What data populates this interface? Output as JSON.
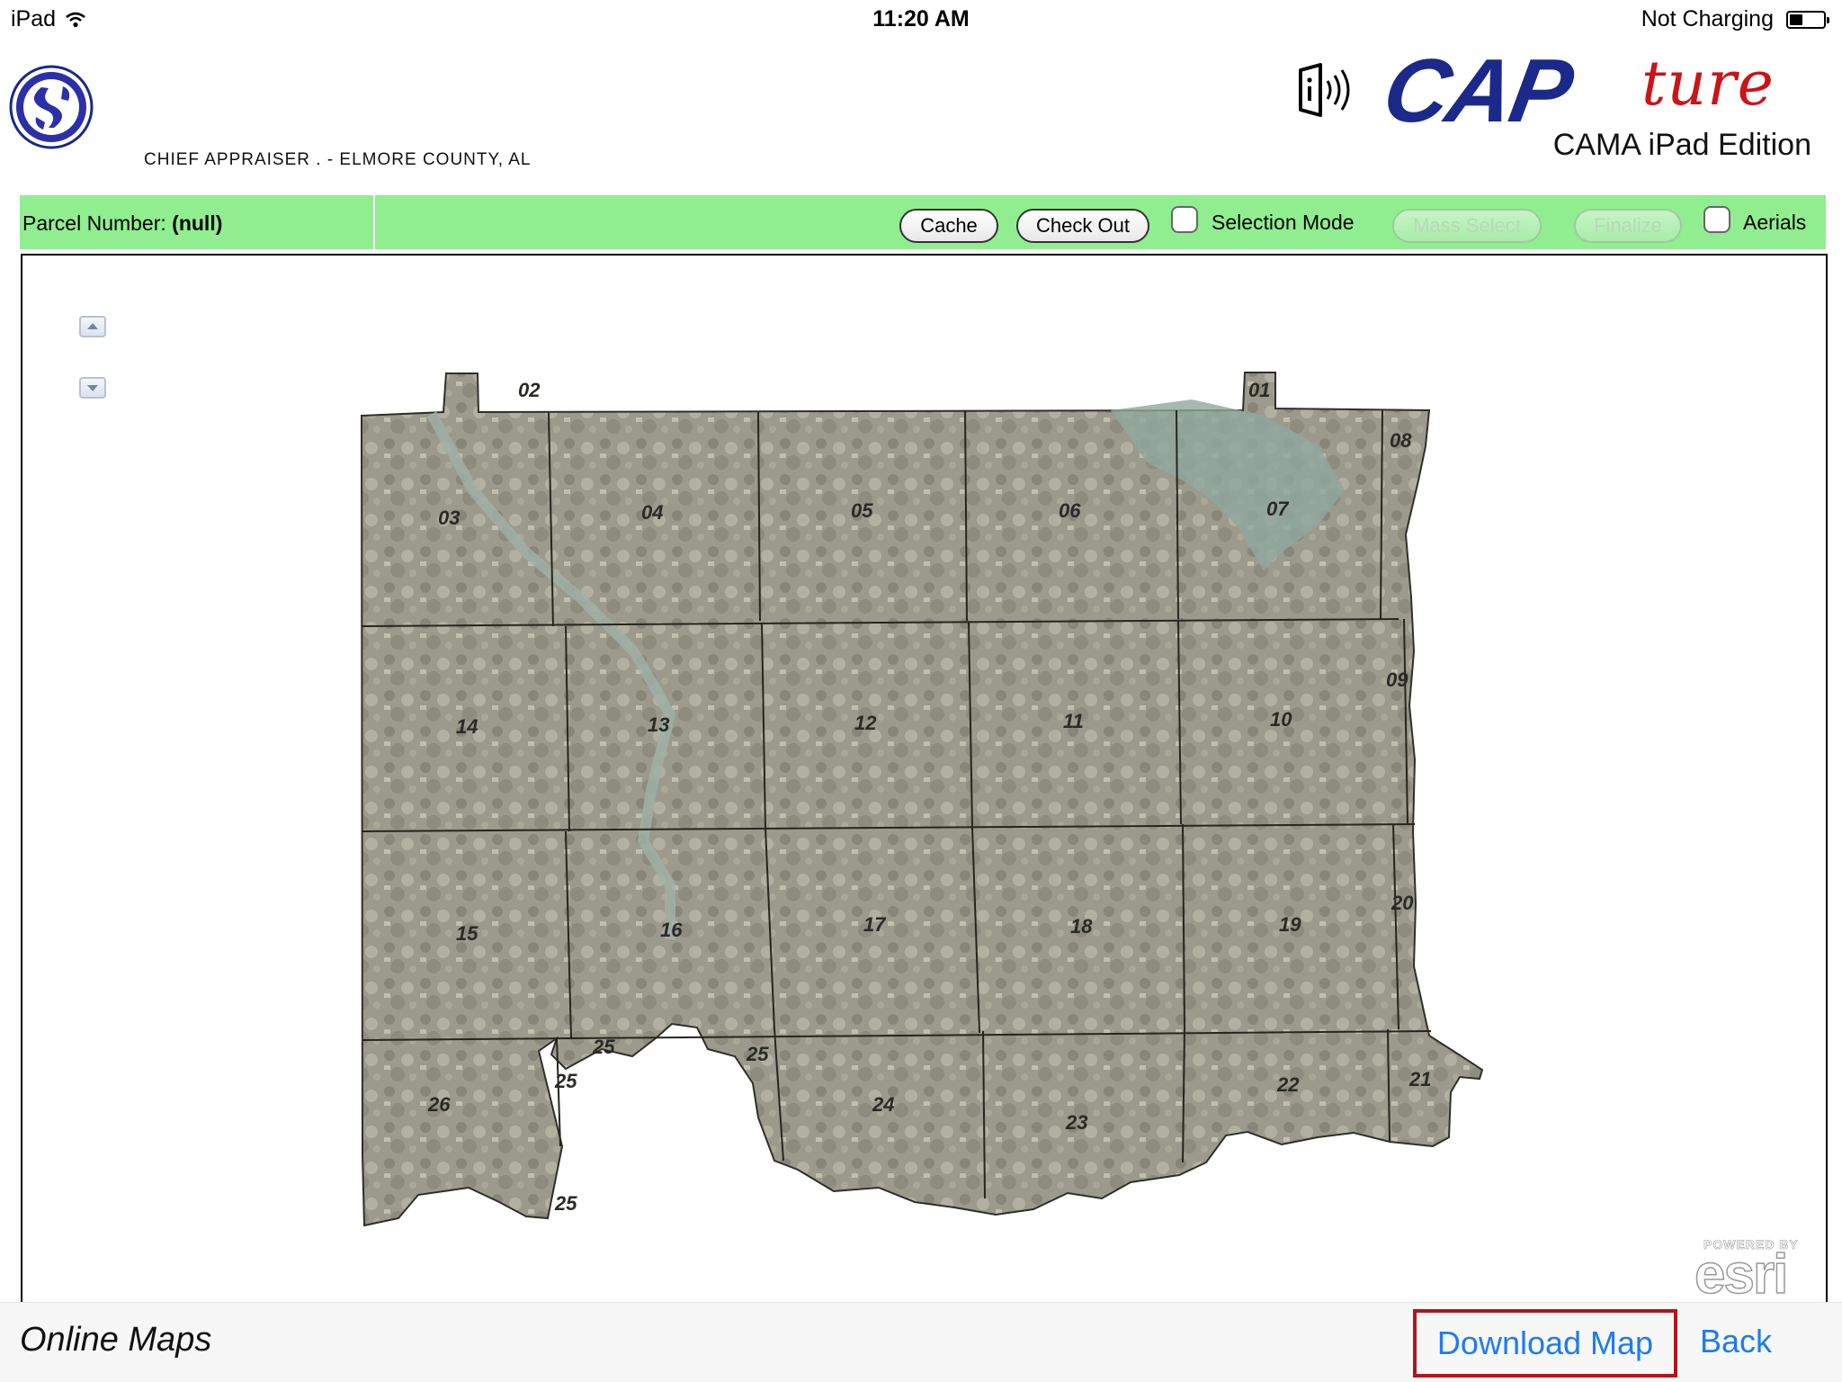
{
  "status_bar": {
    "device": "iPad",
    "time": "11:20 AM",
    "battery_text": "Not Charging",
    "battery_level_percent": 40,
    "wifi_icon": "wifi-icon",
    "battery_icon": "battery-icon"
  },
  "header": {
    "org_name": "CHIEF APPRAISER . - ELMORE COUNTY, AL",
    "brand_primary": "CAP",
    "brand_secondary": "ture",
    "edition": "CAMA iPad Edition",
    "colors": {
      "brand_blue": "#1b2a8a",
      "brand_red": "#cc1418"
    }
  },
  "toolbar": {
    "background": "#90ee90",
    "parcel_label": "Parcel Number:",
    "parcel_value": "(null)",
    "cache_label": "Cache",
    "check_out_label": "Check Out",
    "selection_mode_label": "Selection Mode",
    "selection_mode_checked": false,
    "mass_select_label": "Mass Select",
    "finalize_label": "Finalize",
    "aerials_label": "Aerials",
    "aerials_checked": false
  },
  "map": {
    "sections": [
      "01",
      "02",
      "03",
      "04",
      "05",
      "06",
      "07",
      "08",
      "09",
      "10",
      "11",
      "12",
      "13",
      "14",
      "15",
      "16",
      "17",
      "18",
      "19",
      "20",
      "21",
      "22",
      "23",
      "24",
      "25",
      "25",
      "25",
      "25",
      "26"
    ],
    "attribution_small": "POWERED BY",
    "attribution_big": "esri"
  },
  "bottom_bar": {
    "title": "Online Maps",
    "download_label": "Download Map",
    "back_label": "Back",
    "link_color": "#1d7bf3",
    "highlight_color": "#b0161b"
  }
}
